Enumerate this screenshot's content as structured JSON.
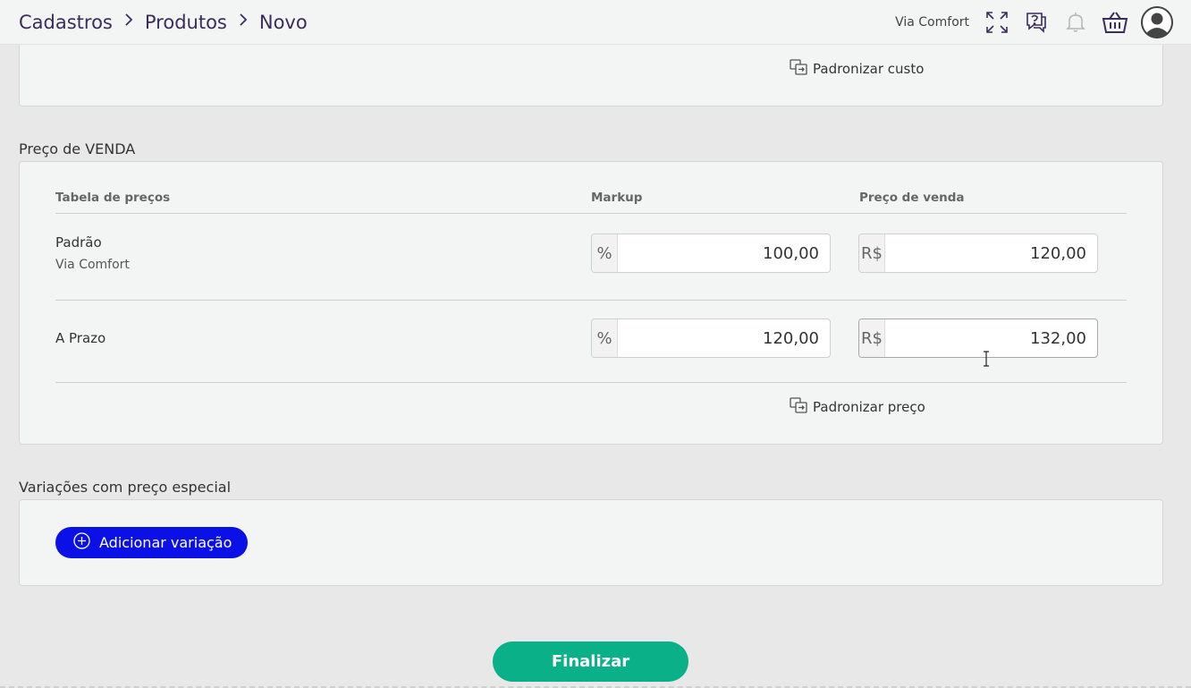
{
  "header": {
    "breadcrumb": [
      "Cadastros",
      "Produtos",
      "Novo"
    ],
    "company": "Via Comfort"
  },
  "custo": {
    "standardize_label": "Padronizar custo"
  },
  "venda": {
    "title": "Preço de VENDA",
    "columns": [
      "Tabela de preços",
      "Markup",
      "Preço de venda"
    ],
    "rows": [
      {
        "name": "Padrão",
        "sub": "Via Comfort",
        "markup_prefix": "%",
        "markup": "100,00",
        "price_prefix": "R$",
        "price": "120,00"
      },
      {
        "name": "A Prazo",
        "markup_prefix": "%",
        "markup": "120,00",
        "price_prefix": "R$",
        "price": "132,00"
      }
    ],
    "standardize_label": "Padronizar preço"
  },
  "variacoes": {
    "title": "Variações com preço especial",
    "add_label": "Adicionar variação"
  },
  "footer": {
    "finish_label": "Finalizar"
  },
  "colors": {
    "brand_text": "#3a2d5c",
    "add_button": "#0a10e6",
    "finish_button": "#0ab087"
  },
  "icons": [
    "chevron-right-icon",
    "fullscreen-icon",
    "help-chat-icon",
    "bell-icon",
    "basket-icon",
    "user-avatar-icon",
    "copy-standardize-icon",
    "plus-circle-icon"
  ]
}
